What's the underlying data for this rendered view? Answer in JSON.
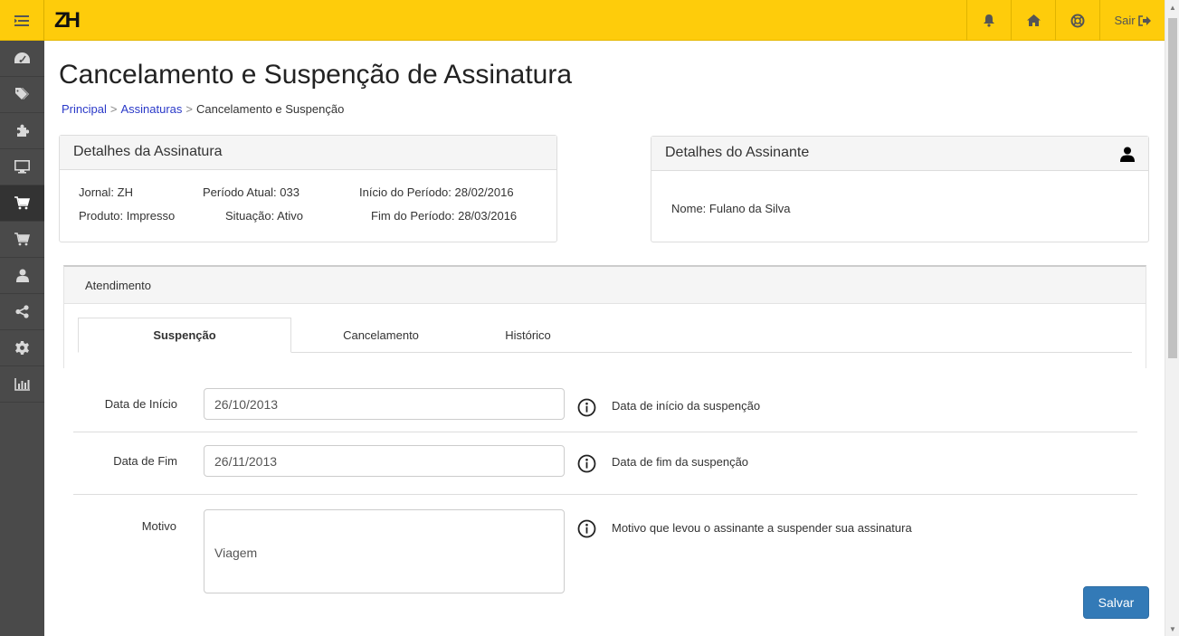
{
  "topbar": {
    "logo": "ZH",
    "logout_label": "Sair"
  },
  "page": {
    "title": "Cancelamento e Suspenção de Assinatura",
    "breadcrumb": [
      "Principal",
      "Assinaturas",
      "Cancelamento e Suspenção"
    ]
  },
  "subscription": {
    "title": "Detalhes da Assinatura",
    "jornal": "Jornal: ZH",
    "periodo_atual": "Período Atual: 033",
    "inicio_periodo": "Início do Período: 28/02/2016",
    "produto": "Produto: Impresso",
    "situacao": "Situação: Ativo",
    "fim_periodo": "Fim do Período: 28/03/2016"
  },
  "subscriber": {
    "title": "Detalhes do Assinante",
    "nome": "Nome: Fulano da Silva"
  },
  "atendimento": {
    "title": "Atendimento",
    "tabs": [
      "Suspenção",
      "Cancelamento",
      "Histórico"
    ]
  },
  "form": {
    "start_label": "Data de Início",
    "start_value": "26/10/2013",
    "start_help": "Data de início da suspenção",
    "end_label": "Data de Fim",
    "end_value": "26/11/2013",
    "end_help": "Data de fim da suspenção",
    "reason_label": "Motivo",
    "reason_value": "Viagem",
    "reason_help": "Motivo que levou o assinante a suspender sua assinatura",
    "save_label": "Salvar"
  },
  "colors": {
    "topbar": "#fecc0b",
    "sidebar": "#4a4a4a",
    "primary": "#337ab7",
    "link": "#2a39c8"
  },
  "icons": {
    "sidebar": [
      "dashboard-icon",
      "tags-icon",
      "puzzle-icon",
      "monitor-icon",
      "cart-icon",
      "cart-icon",
      "user-icon",
      "share-icon",
      "gear-icon",
      "bar-chart-icon"
    ],
    "topbar": [
      "bell-icon",
      "home-icon",
      "lifebuoy-icon",
      "sign-out-icon"
    ]
  }
}
